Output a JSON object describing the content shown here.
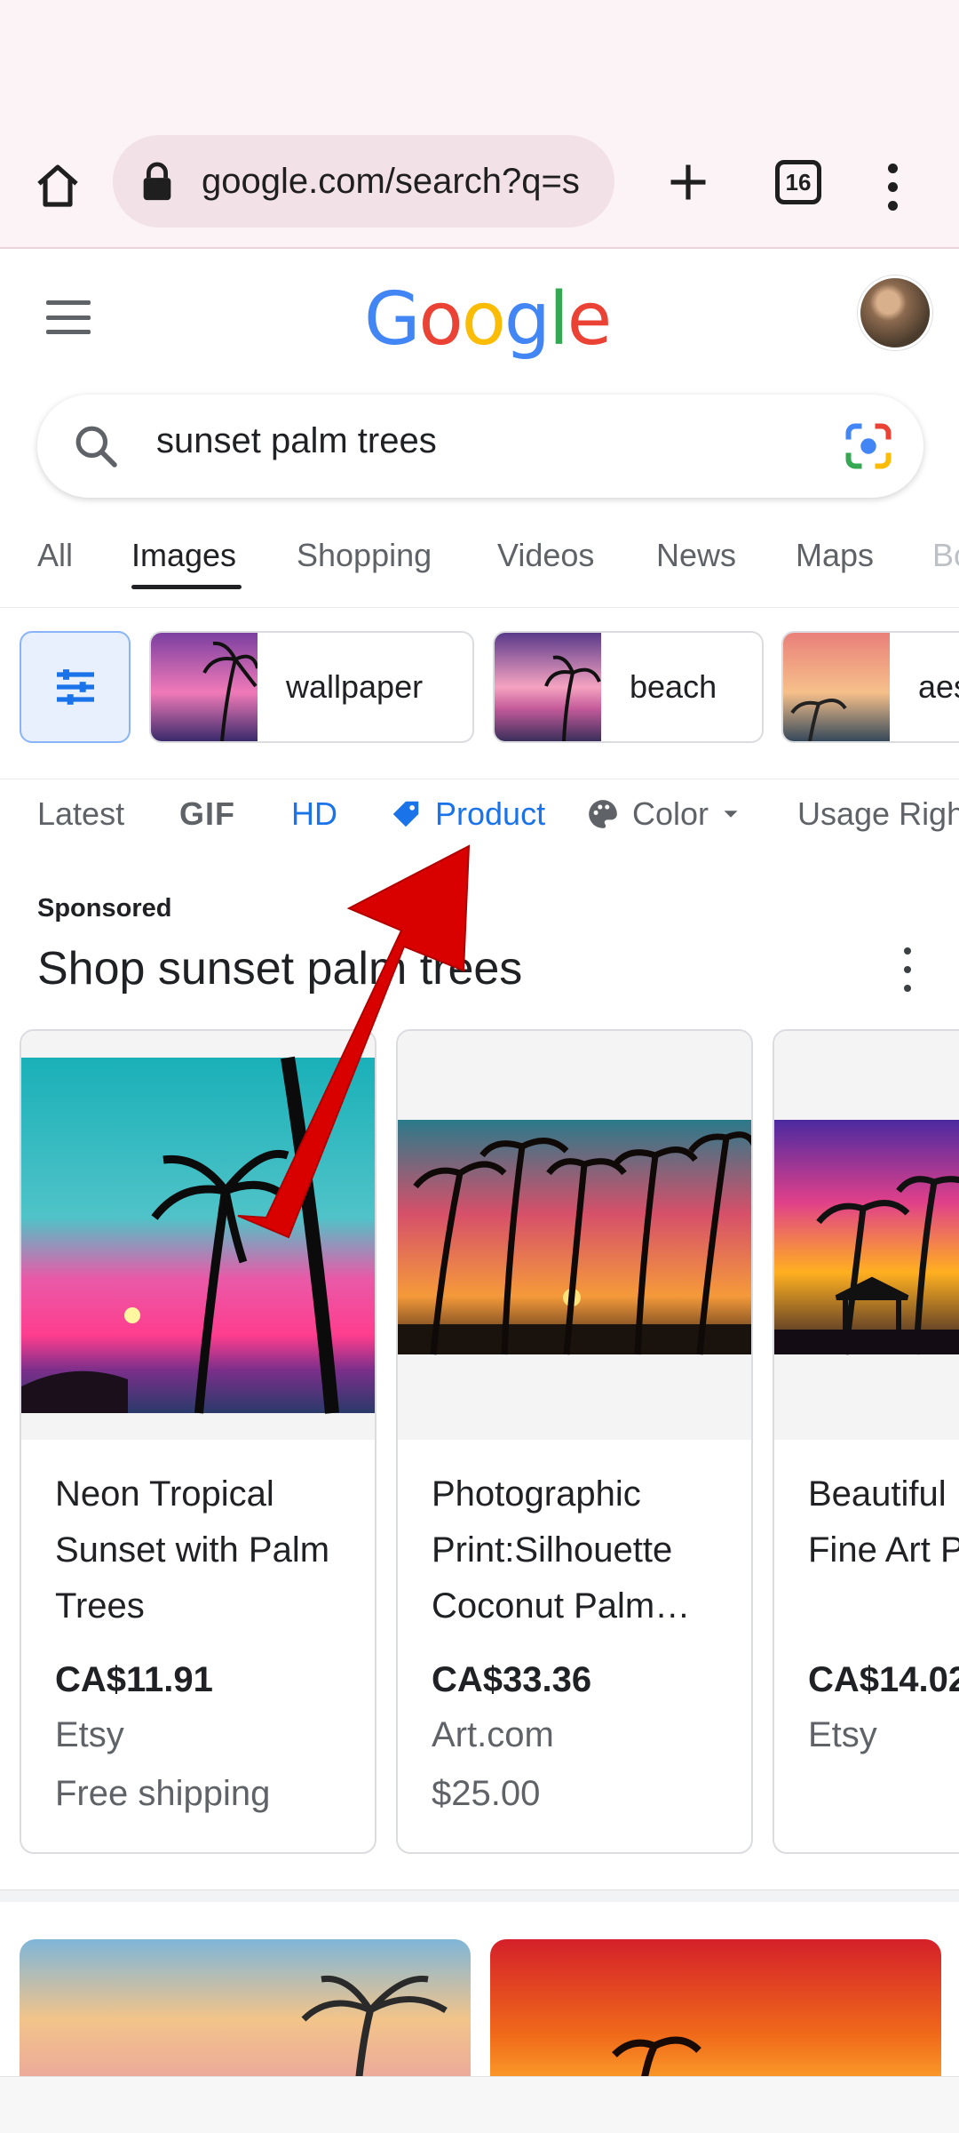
{
  "browser": {
    "url": "google.com/search?q=s",
    "tab_count": "16"
  },
  "google": {
    "logo": [
      "G",
      "o",
      "o",
      "g",
      "l",
      "e"
    ],
    "search_query": "sunset palm trees"
  },
  "tabs": [
    "All",
    "Images",
    "Shopping",
    "Videos",
    "News",
    "Maps",
    "Bo"
  ],
  "active_tab": "Images",
  "chips": [
    {
      "label": "wallpaper"
    },
    {
      "label": "beach"
    },
    {
      "label": "aes"
    }
  ],
  "filters": {
    "latest": "Latest",
    "gif": "GIF",
    "hd": "HD",
    "product": "Product",
    "color": "Color",
    "usage": "Usage Righ"
  },
  "sponsored": {
    "label": "Sponsored",
    "title": "Shop sunset palm trees"
  },
  "products": [
    {
      "name": "Neon Tropical Sunset with Palm Trees",
      "price": "CA$11.91",
      "store": "Etsy",
      "extra": "Free shipping"
    },
    {
      "name": "Photographic Print:Silhouette Coconut Palm…",
      "price": "CA$33.36",
      "store": "Art.com",
      "extra": "$25.00"
    },
    {
      "name": "Beautiful Hawaiian Fine Art P",
      "price": "CA$14.02",
      "store": "Etsy",
      "extra": ""
    }
  ],
  "colors": {
    "accent": "#1a73e8",
    "annotation_arrow": "#d90000",
    "chrome_bg": "#fbf3f6"
  }
}
